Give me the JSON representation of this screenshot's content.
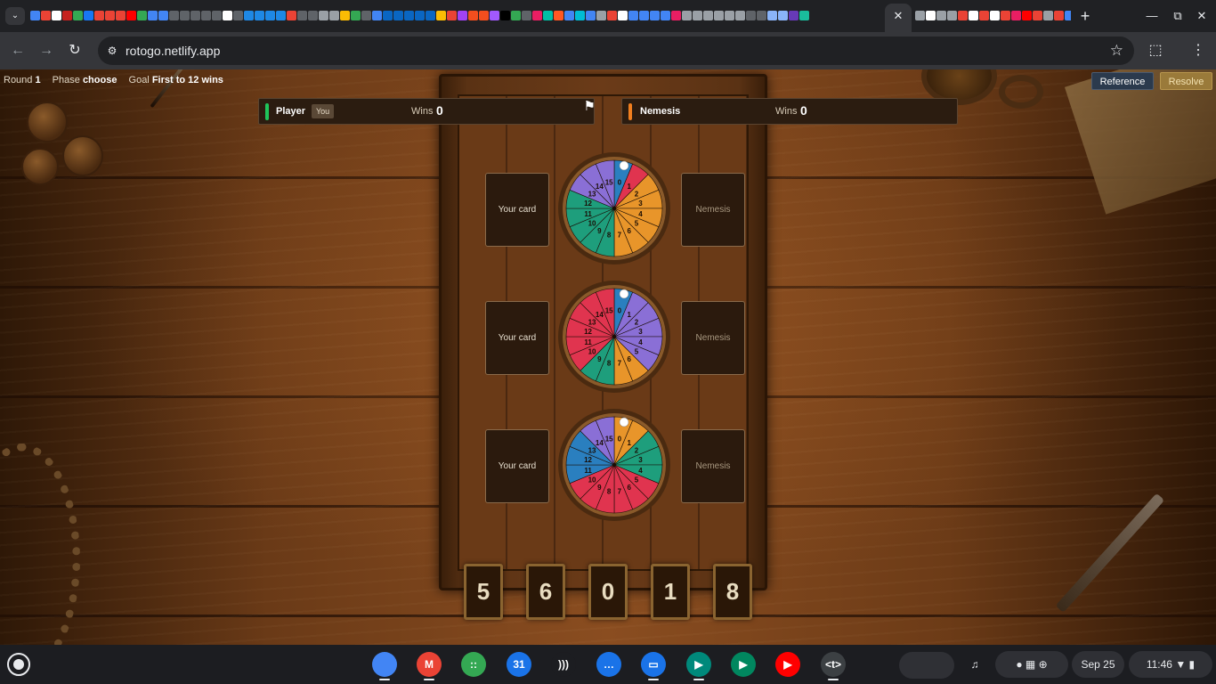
{
  "browser": {
    "url": "rotogo.netlify.app",
    "tab_favicon_colors": [
      "#4285f4",
      "#ea4335",
      "#ffffff",
      "#c5221f",
      "#34a853",
      "#1877f2",
      "#ea4335",
      "#ea4335",
      "#ea4335",
      "#ff0000",
      "#34a853",
      "#4285f4",
      "#4285f4",
      "#5f6368",
      "#5f6368",
      "#5f6368",
      "#5f6368",
      "#5f6368",
      "#ffffff",
      "#5f6368",
      "#1e88e5",
      "#1e88e5",
      "#1e88e5",
      "#1e88e5",
      "#ea4335",
      "#5f6368",
      "#5f6368",
      "#9aa0a6",
      "#9aa0a6",
      "#fbbc04",
      "#34a853",
      "#5f6368",
      "#4285f4",
      "#0a66c2",
      "#0a66c2",
      "#0a66c2",
      "#0a66c2",
      "#0a66c2",
      "#fbbc04",
      "#ea4335",
      "#a142f4",
      "#f24e1e",
      "#f24e1e",
      "#a259ff",
      "#000000",
      "#34a853",
      "#5f6368",
      "#e91e63",
      "#00bfa5",
      "#ff5722",
      "#4285f4",
      "#00bcd4",
      "#4285f4",
      "#9aa0a6",
      "#ea4335",
      "#ffffff",
      "#4285f4",
      "#4285f4",
      "#4285f4",
      "#4285f4",
      "#e91e63",
      "#9aa0a6",
      "#9aa0a6",
      "#9aa0a6",
      "#9aa0a6",
      "#9aa0a6",
      "#9aa0a6",
      "#5f6368",
      "#5f6368",
      "#8ab4f8",
      "#8ab4f8",
      "#673ab7",
      "#1abc9c"
    ],
    "tab_favicon_colors_2": [
      "#9aa0a6",
      "#ffffff",
      "#9aa0a6",
      "#9aa0a6",
      "#ea4335",
      "#ffffff",
      "#ea4335",
      "#ffffff",
      "#ea4335",
      "#e91e63",
      "#ff0000",
      "#ea4335",
      "#9aa0a6",
      "#ea4335",
      "#4285f4",
      "#ffffff"
    ]
  },
  "game": {
    "status": {
      "round_label": "Round",
      "round_value": "1",
      "phase_label": "Phase",
      "phase_value": "choose",
      "goal_label": "Goal",
      "goal_value": "First to 12 wins"
    },
    "buttons": {
      "reference": "Reference",
      "resolve": "Resolve"
    },
    "player": {
      "name": "Player",
      "badge": "You",
      "wins_label": "Wins",
      "wins": "0",
      "color": "#1fc45a"
    },
    "nemesis": {
      "name": "Nemesis",
      "wins_label": "Wins",
      "wins": "0",
      "color": "#f07f1f"
    },
    "lanes": [
      {
        "your_card": "Your card",
        "enemy_card": "Nemesis",
        "segments": [
          "blue",
          "red",
          "orange",
          "orange",
          "orange",
          "orange",
          "orange",
          "orange",
          "green",
          "green",
          "green",
          "green",
          "green",
          "purple",
          "purple",
          "purple"
        ]
      },
      {
        "your_card": "Your card",
        "enemy_card": "Nemesis",
        "segments": [
          "blue",
          "purple",
          "purple",
          "purple",
          "purple",
          "purple",
          "orange",
          "orange",
          "green",
          "green",
          "red",
          "red",
          "red",
          "red",
          "red",
          "red"
        ]
      },
      {
        "your_card": "Your card",
        "enemy_card": "Nemesis",
        "segments": [
          "orange",
          "orange",
          "green",
          "green",
          "green",
          "red",
          "red",
          "red",
          "red",
          "red",
          "red",
          "blue",
          "blue",
          "blue",
          "purple",
          "purple"
        ]
      }
    ],
    "segment_colors": {
      "blue": "#2a7fbf",
      "red": "#e0344f",
      "orange": "#e8952a",
      "green": "#1e9e7c",
      "purple": "#8a6fd6"
    },
    "wheel_numbers": [
      "0",
      "1",
      "2",
      "3",
      "4",
      "5",
      "6",
      "7",
      "8",
      "9",
      "10",
      "11",
      "12",
      "13",
      "14",
      "15"
    ],
    "code_digits": [
      "5",
      "6",
      "0",
      "1",
      "8"
    ]
  },
  "shelf": {
    "apps": [
      {
        "name": "chrome",
        "color": "#4285f4",
        "glyph": ""
      },
      {
        "name": "gmail",
        "color": "#ea4335",
        "glyph": "M"
      },
      {
        "name": "apps",
        "color": "#34a853",
        "glyph": "::"
      },
      {
        "name": "calendar",
        "color": "#1a73e8",
        "glyph": "31"
      },
      {
        "name": "cast",
        "color": "#1c1d21",
        "glyph": ")))"
      },
      {
        "name": "messages",
        "color": "#1a73e8",
        "glyph": "…"
      },
      {
        "name": "files",
        "color": "#1a73e8",
        "glyph": "▭"
      },
      {
        "name": "meet",
        "color": "#00897b",
        "glyph": "▶"
      },
      {
        "name": "play",
        "color": "#01875f",
        "glyph": "▶"
      },
      {
        "name": "youtube",
        "color": "#ff0000",
        "glyph": "▶"
      },
      {
        "name": "web-app",
        "color": "#3c4043",
        "glyph": "<t>"
      }
    ],
    "date": "Sep 25",
    "time": "11:46"
  }
}
